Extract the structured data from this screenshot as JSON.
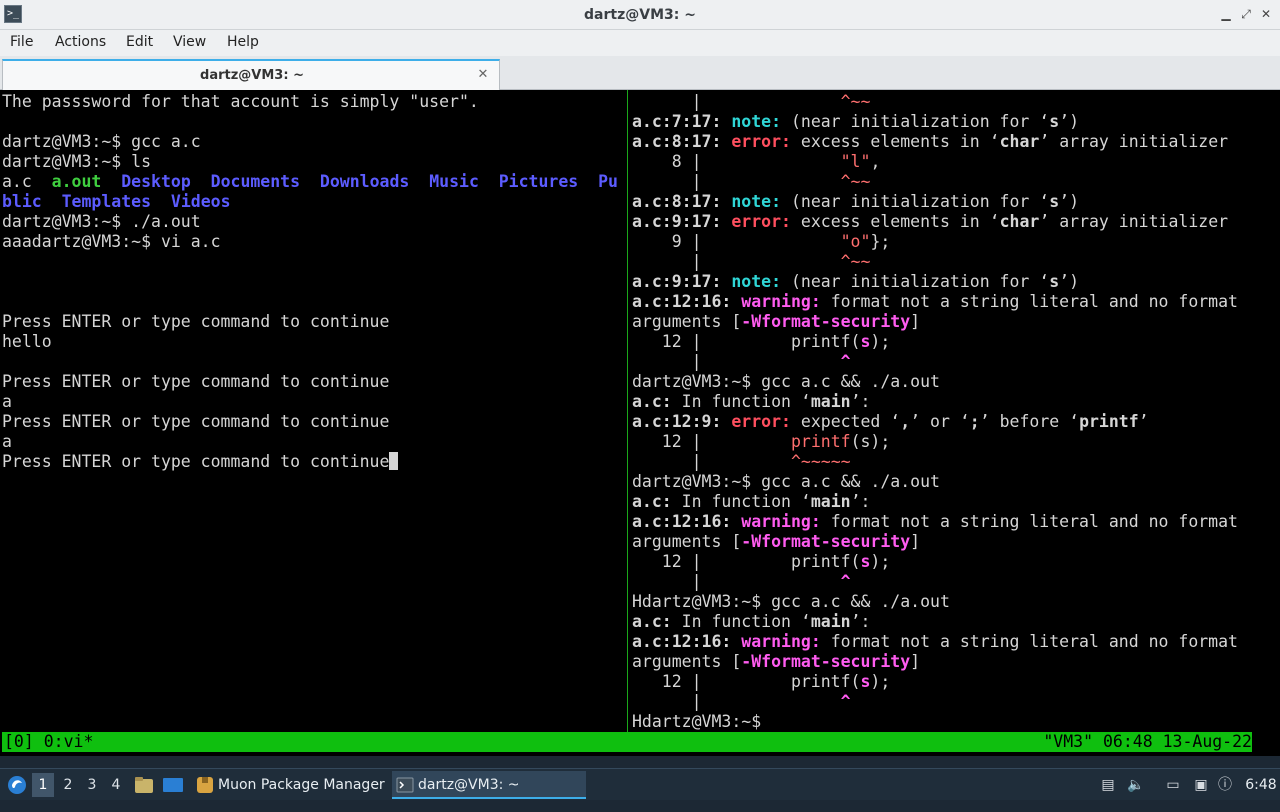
{
  "window": {
    "title": "dartz@VM3: ~",
    "title_icon": ">_"
  },
  "menu": [
    "File",
    "Actions",
    "Edit",
    "View",
    "Help"
  ],
  "tab": {
    "label": "dartz@VM3: ~"
  },
  "left_pane": [
    [
      [
        "The passsword for that account is simply \"user\".",
        ""
      ]
    ],
    [
      [
        "",
        ""
      ]
    ],
    [
      [
        "dartz@VM3:~$ gcc a.c",
        ""
      ]
    ],
    [
      [
        "dartz@VM3:~$ ls",
        ""
      ]
    ],
    [
      [
        "a.c  ",
        ""
      ],
      [
        "a.out",
        "g"
      ],
      [
        "  ",
        ""
      ],
      [
        "Desktop",
        "bl"
      ],
      [
        "  ",
        ""
      ],
      [
        "Documents",
        "bl"
      ],
      [
        "  ",
        ""
      ],
      [
        "Downloads",
        "bl"
      ],
      [
        "  ",
        ""
      ],
      [
        "Music",
        "bl"
      ],
      [
        "  ",
        ""
      ],
      [
        "Pictures",
        "bl"
      ],
      [
        "  ",
        ""
      ],
      [
        "Pu",
        "bl"
      ]
    ],
    [
      [
        "blic",
        "bl"
      ],
      [
        "  ",
        ""
      ],
      [
        "Templates",
        "bl"
      ],
      [
        "  ",
        ""
      ],
      [
        "Videos",
        "bl"
      ]
    ],
    [
      [
        "dartz@VM3:~$ ./a.out",
        ""
      ]
    ],
    [
      [
        "aaadartz@VM3:~$ vi a.c",
        ""
      ]
    ],
    [
      [
        "",
        ""
      ]
    ],
    [
      [
        "",
        ""
      ]
    ],
    [
      [
        "",
        ""
      ]
    ],
    [
      [
        "Press ENTER or type command to continue",
        ""
      ]
    ],
    [
      [
        "hello",
        ""
      ]
    ],
    [
      [
        "",
        ""
      ]
    ],
    [
      [
        "Press ENTER or type command to continue",
        ""
      ]
    ],
    [
      [
        "a",
        ""
      ]
    ],
    [
      [
        "Press ENTER or type command to continue",
        ""
      ]
    ],
    [
      [
        "a",
        ""
      ]
    ],
    [
      [
        "Press ENTER or type command to continue",
        ""
      ]
    ]
  ],
  "right_pane": [
    [
      [
        "      |              ",
        ""
      ],
      [
        "^~~",
        "k"
      ]
    ],
    [
      [
        "a.c:7:17: ",
        "b"
      ],
      [
        "note:",
        "c"
      ],
      [
        " (near initialization for ‘",
        ""
      ],
      [
        "s",
        "b"
      ],
      [
        "’)",
        ""
      ]
    ],
    [
      [
        "a.c:8:17: ",
        "b"
      ],
      [
        "error:",
        "r"
      ],
      [
        " excess elements in ‘",
        ""
      ],
      [
        "char",
        "b"
      ],
      [
        "’ array initializer",
        ""
      ]
    ],
    [
      [
        "    8 |              ",
        ""
      ],
      [
        "\"l\"",
        "k"
      ],
      [
        ",",
        ""
      ]
    ],
    [
      [
        "      |              ",
        ""
      ],
      [
        "^~~",
        "k"
      ]
    ],
    [
      [
        "a.c:8:17: ",
        "b"
      ],
      [
        "note:",
        "c"
      ],
      [
        " (near initialization for ‘",
        ""
      ],
      [
        "s",
        "b"
      ],
      [
        "’)",
        ""
      ]
    ],
    [
      [
        "a.c:9:17: ",
        "b"
      ],
      [
        "error:",
        "r"
      ],
      [
        " excess elements in ‘",
        ""
      ],
      [
        "char",
        "b"
      ],
      [
        "’ array initializer",
        ""
      ]
    ],
    [
      [
        "    9 |              ",
        ""
      ],
      [
        "\"o\"",
        "k"
      ],
      [
        "};",
        ""
      ]
    ],
    [
      [
        "      |              ",
        ""
      ],
      [
        "^~~",
        "k"
      ]
    ],
    [
      [
        "a.c:9:17: ",
        "b"
      ],
      [
        "note:",
        "c"
      ],
      [
        " (near initialization for ‘",
        ""
      ],
      [
        "s",
        "b"
      ],
      [
        "’)",
        ""
      ]
    ],
    [
      [
        "a.c:12:16: ",
        "b"
      ],
      [
        "warning:",
        "m"
      ],
      [
        " format not a string literal and no format",
        ""
      ]
    ],
    [
      [
        "arguments [",
        ""
      ],
      [
        "-Wformat-security",
        "m"
      ],
      [
        "]",
        ""
      ]
    ],
    [
      [
        "   12 |         printf(",
        ""
      ],
      [
        "s",
        "m"
      ],
      [
        ");",
        ""
      ]
    ],
    [
      [
        "      |              ",
        ""
      ],
      [
        "^",
        "m"
      ]
    ],
    [
      [
        "dartz@VM3:~$ gcc a.c && ./a.out",
        ""
      ]
    ],
    [
      [
        "a.c:",
        "b"
      ],
      [
        " In function ‘",
        ""
      ],
      [
        "main",
        "b"
      ],
      [
        "’:",
        ""
      ]
    ],
    [
      [
        "a.c:12:9: ",
        "b"
      ],
      [
        "error:",
        "r"
      ],
      [
        " expected ‘",
        ""
      ],
      [
        ",",
        "b"
      ],
      [
        "’ or ‘",
        ""
      ],
      [
        ";",
        "b"
      ],
      [
        "’ before ‘",
        ""
      ],
      [
        "printf",
        "b"
      ],
      [
        "’",
        ""
      ]
    ],
    [
      [
        "   12 |         ",
        ""
      ],
      [
        "printf",
        "k"
      ],
      [
        "(s);",
        ""
      ]
    ],
    [
      [
        "      |         ",
        ""
      ],
      [
        "^~~~~~",
        "k"
      ]
    ],
    [
      [
        "dartz@VM3:~$ gcc a.c && ./a.out",
        ""
      ]
    ],
    [
      [
        "a.c:",
        "b"
      ],
      [
        " In function ‘",
        ""
      ],
      [
        "main",
        "b"
      ],
      [
        "’:",
        ""
      ]
    ],
    [
      [
        "a.c:12:16: ",
        "b"
      ],
      [
        "warning:",
        "m"
      ],
      [
        " format not a string literal and no format",
        ""
      ]
    ],
    [
      [
        "arguments [",
        ""
      ],
      [
        "-Wformat-security",
        "m"
      ],
      [
        "]",
        ""
      ]
    ],
    [
      [
        "   12 |         printf(",
        ""
      ],
      [
        "s",
        "m"
      ],
      [
        ");",
        ""
      ]
    ],
    [
      [
        "      |              ",
        ""
      ],
      [
        "^",
        "m"
      ]
    ],
    [
      [
        "Hdartz@VM3:~$ gcc a.c && ./a.out",
        ""
      ]
    ],
    [
      [
        "a.c:",
        "b"
      ],
      [
        " In function ‘",
        ""
      ],
      [
        "main",
        "b"
      ],
      [
        "’:",
        ""
      ]
    ],
    [
      [
        "a.c:12:16: ",
        "b"
      ],
      [
        "warning:",
        "m"
      ],
      [
        " format not a string literal and no format",
        ""
      ]
    ],
    [
      [
        "arguments [",
        ""
      ],
      [
        "-Wformat-security",
        "m"
      ],
      [
        "]",
        ""
      ]
    ],
    [
      [
        "   12 |         printf(",
        ""
      ],
      [
        "s",
        "m"
      ],
      [
        ");",
        ""
      ]
    ],
    [
      [
        "      |              ",
        ""
      ],
      [
        "^",
        "m"
      ]
    ],
    [
      [
        "Hdartz@VM3:~$ ",
        ""
      ]
    ]
  ],
  "tmux_status": {
    "left": "[0] 0:vi*",
    "right": "\"VM3\" 06:48 13-Aug-22"
  },
  "taskbar": {
    "workspaces": [
      "1",
      "2",
      "3",
      "4"
    ],
    "active_workspace": "1",
    "tasks": [
      {
        "label": "Muon Package Manager",
        "icon": "package-icon"
      },
      {
        "label": "dartz@VM3: ~",
        "icon": "terminal-icon",
        "active": true
      }
    ],
    "clock": "6:48"
  },
  "colors": {
    "accent": "#3daee9",
    "tmux_bar": "#0fbf0f",
    "pane_divider": "#1aa81a",
    "taskbar": "#1f2d3a",
    "dir_blue": "#5c5cff",
    "exec_green": "#3fcf3f",
    "error_red": "#ff4f5f",
    "note_cyan": "#2fd6d6",
    "warning_magenta": "#ff5cf0"
  }
}
